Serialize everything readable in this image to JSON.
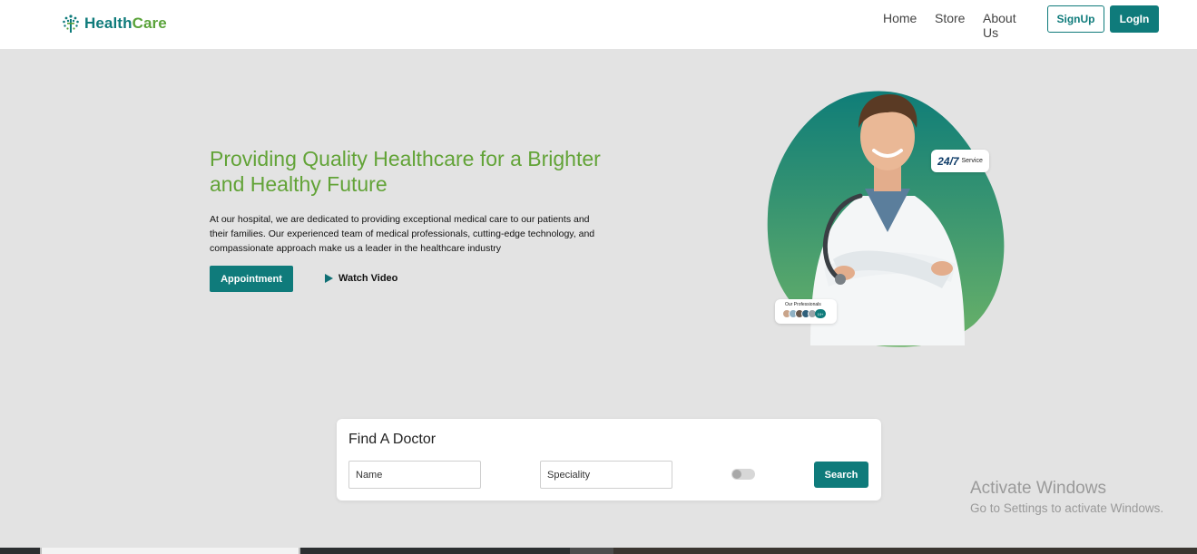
{
  "header": {
    "brand_part1": "Health",
    "brand_part2": "Care",
    "brand_icon": "caduceus-tree-icon",
    "nav": [
      "Home",
      "Store",
      "About Us"
    ],
    "signup_label": "SignUp",
    "login_label": "LogIn"
  },
  "hero": {
    "title": "Providing Quality Healthcare for a Brighter and Healthy Future",
    "description": "At our hospital, we are dedicated to providing exceptional medical care to our patients and their families. Our experienced team of medical professionals, cutting-edge technology, and compassionate approach make us a leader in the healthcare industry",
    "appointment_label": "Appointment",
    "watch_label": "Watch Video",
    "badge_24_num": "24/7",
    "badge_24_text": "Service",
    "professionals_label": "Our Professionals",
    "professionals_more": "10+"
  },
  "finder": {
    "title": "Find A Doctor",
    "name_placeholder": "Name",
    "speciality_placeholder": "Speciality",
    "search_label": "Search"
  },
  "activation": {
    "title": "Activate Windows",
    "subtitle": "Go to Settings to activate Windows."
  },
  "colors": {
    "primary": "#0f7b7b",
    "accent_green": "#62a337",
    "page_bg": "#e3e3e3"
  }
}
